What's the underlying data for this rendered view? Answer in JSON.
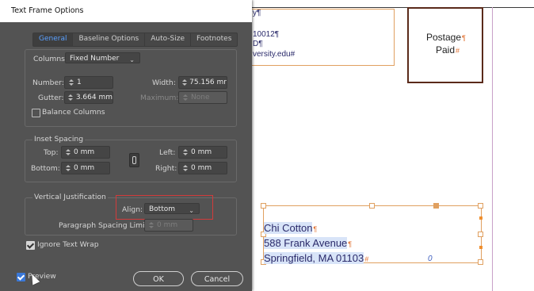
{
  "dialog": {
    "title": "Text Frame Options",
    "tabs": [
      {
        "label": "General",
        "active": true
      },
      {
        "label": "Baseline Options",
        "active": false
      },
      {
        "label": "Auto-Size",
        "active": false
      },
      {
        "label": "Footnotes",
        "active": false
      }
    ],
    "columns": {
      "label": "Columns:",
      "value": "Fixed Number",
      "number_label": "Number:",
      "number_value": "1",
      "width_label": "Width:",
      "width_value": "75.156 mr",
      "gutter_label": "Gutter:",
      "gutter_value": "3.664 mm",
      "maximum_label": "Maximum:",
      "maximum_value": "None",
      "balance_label": "Balance Columns",
      "balance_checked": false
    },
    "inset": {
      "group_label": "Inset Spacing",
      "top_label": "Top:",
      "top_value": "0 mm",
      "bottom_label": "Bottom:",
      "bottom_value": "0 mm",
      "left_label": "Left:",
      "left_value": "0 mm",
      "right_label": "Right:",
      "right_value": "0 mm"
    },
    "vertical": {
      "group_label": "Vertical Justification",
      "align_label": "Align:",
      "align_value": "Bottom",
      "para_limit_label": "Paragraph Spacing Limit:",
      "para_limit_value": "0 mm"
    },
    "ignore_wrap": {
      "label": "Ignore Text Wrap",
      "checked": true
    },
    "preview": {
      "label": "Preview",
      "checked": true
    },
    "ok_label": "OK",
    "cancel_label": "Cancel"
  },
  "document": {
    "top_frame_lines": [
      "y¶",
      "10012¶",
      "D¶",
      "versity.edu#"
    ],
    "postage_line1": "Postage",
    "postage_line2": "Paid",
    "address_lines": [
      "Chi Cotton",
      "588 Frank Avenue",
      "Springfield, MA 01103"
    ],
    "pilcrow": "¶",
    "hash": "#",
    "overflow_marker": "0"
  },
  "colors": {
    "dialog_bg": "#535353",
    "active_tab": "#5aa0ff",
    "highlight_box": "#d23b3b",
    "frame_orange": "#e0a060",
    "text_blue": "#2a2a6a"
  }
}
